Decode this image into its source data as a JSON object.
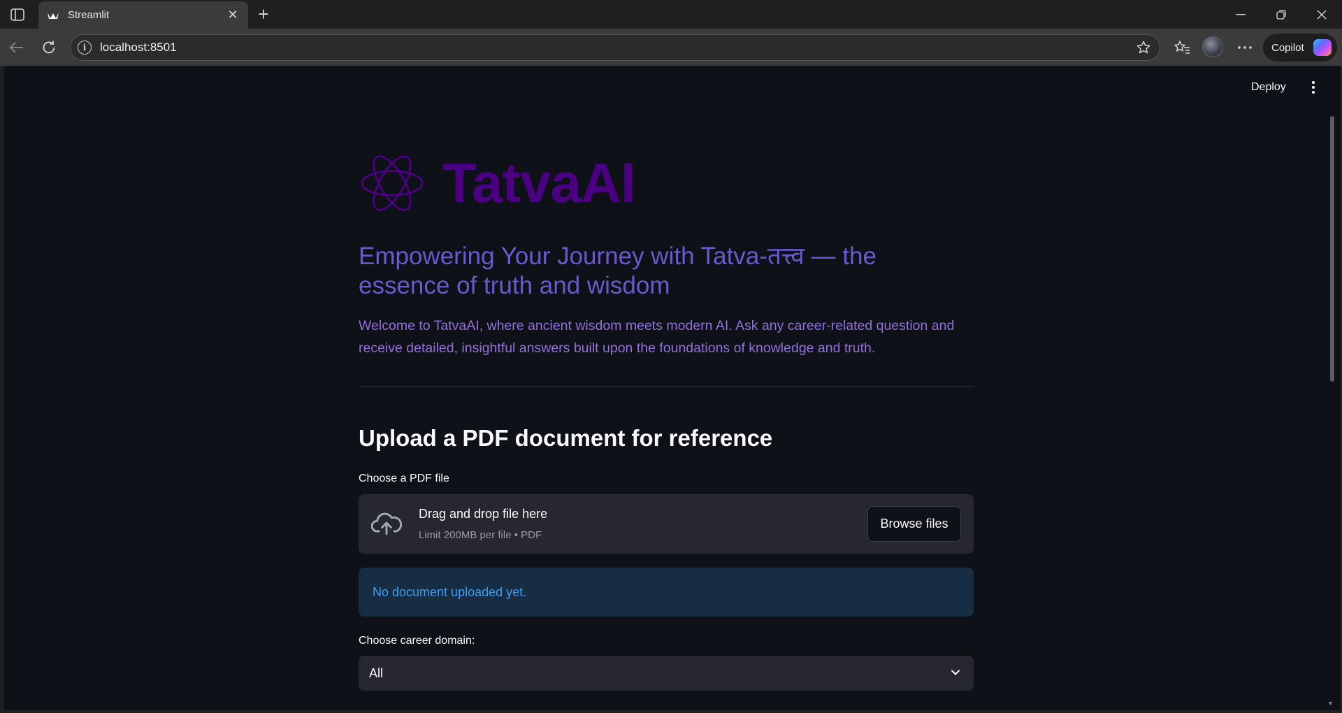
{
  "browser": {
    "tab_title": "Streamlit",
    "url": "localhost:8501",
    "copilot_label": "Copilot"
  },
  "app": {
    "deploy_label": "Deploy",
    "brand_name": "TatvaAI",
    "tagline": "Empowering Your Journey with Tatva-तत्त्व — the essence of truth and wisdom",
    "welcome": "Welcome to TatvaAI, where ancient wisdom meets modern AI. Ask any career-related question and receive detailed, insightful answers built upon the foundations of knowledge and truth.",
    "upload_heading": "Upload a PDF document for reference",
    "file_label": "Choose a PDF file",
    "dropzone_title": "Drag and drop file here",
    "dropzone_sub": "Limit 200MB per file • PDF",
    "browse_label": "Browse files",
    "info_message": "No document uploaded yet.",
    "domain_label": "Choose career domain:",
    "domain_selected": "All"
  },
  "colors": {
    "brand": "#4b0082",
    "tagline": "#6a5acd",
    "welcome": "#9370db",
    "info_text": "#3d9df3",
    "background": "#0e1117"
  },
  "icons": [
    "sidebar-toggle-icon",
    "streamlit-favicon-icon",
    "close-icon",
    "plus-icon",
    "minimize-icon",
    "restore-icon",
    "back-arrow-icon",
    "refresh-icon",
    "info-icon",
    "star-icon",
    "favorites-icon",
    "more-icon",
    "atom-icon",
    "cloud-upload-icon",
    "chevron-down-icon"
  ]
}
